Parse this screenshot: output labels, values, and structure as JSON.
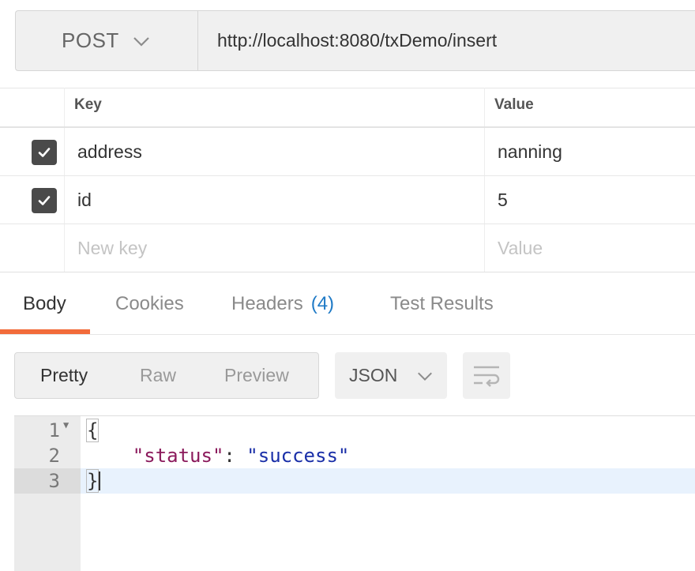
{
  "request": {
    "method": "POST",
    "url": "http://localhost:8080/txDemo/insert"
  },
  "params": {
    "headers": {
      "key": "Key",
      "value": "Value"
    },
    "rows": [
      {
        "checked": true,
        "key": "address",
        "value": "nanning"
      },
      {
        "checked": true,
        "key": "id",
        "value": "5"
      }
    ],
    "new_row": {
      "key_placeholder": "New key",
      "value_placeholder": "Value"
    }
  },
  "response": {
    "tabs": [
      {
        "label": "Body",
        "active": true
      },
      {
        "label": "Cookies"
      },
      {
        "label": "Headers",
        "count": "(4)"
      },
      {
        "label": "Test Results"
      }
    ],
    "views": [
      {
        "label": "Pretty",
        "active": true
      },
      {
        "label": "Raw"
      },
      {
        "label": "Preview"
      }
    ],
    "format": "JSON",
    "code": {
      "lines": [
        {
          "num": "1",
          "open": "{"
        },
        {
          "num": "2",
          "key": "\"status\"",
          "colon": ": ",
          "value": "\"success\""
        },
        {
          "num": "3",
          "close": "}"
        }
      ]
    }
  },
  "colors": {
    "accent": "#f26b3a",
    "count_blue": "#1f7ac6",
    "json_key": "#8b1a5c",
    "json_string": "#1a2fa8"
  },
  "icons": [
    "chevron-down-icon",
    "checkmark-icon",
    "wrap-lines-icon"
  ]
}
